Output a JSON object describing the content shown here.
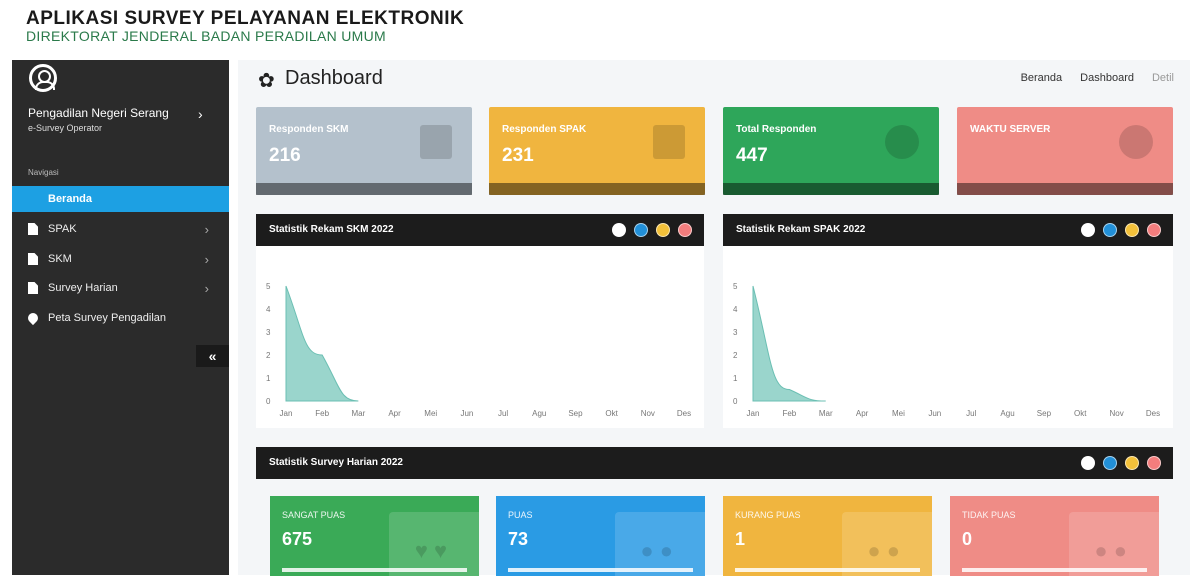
{
  "app": {
    "title": "APLIKASI SURVEY PELAYANAN ELEKTRONIK",
    "subtitle": "DIREKTORAT JENDERAL BADAN PERADILAN UMUM"
  },
  "sidebar": {
    "user_name": "Pengadilan Negeri Serang",
    "user_role": "e-Survey Operator",
    "nav_heading": "Navigasi",
    "items": [
      {
        "label": "Beranda",
        "active": true,
        "icon": "none"
      },
      {
        "label": "SPAK",
        "icon": "file-icon"
      },
      {
        "label": "SKM",
        "icon": "file-icon"
      },
      {
        "label": "Survey Harian",
        "icon": "file-icon"
      },
      {
        "label": "Peta Survey Pengadilan",
        "icon": "map-pin-icon"
      }
    ],
    "collapse_label": "«"
  },
  "main": {
    "page_title": "Dashboard",
    "breadcrumb": [
      "Beranda",
      "Dashboard",
      "Detil"
    ]
  },
  "stat_boxes": [
    {
      "label": "Responden SKM",
      "value": "216",
      "color": "#b4c1cc"
    },
    {
      "label": "Responden SPAK",
      "value": "231",
      "color": "#f0b53f"
    },
    {
      "label": "Total Responden",
      "value": "447",
      "color": "#2ea65a"
    },
    {
      "label": "WAKTU SERVER",
      "value": "",
      "color": "#ef8c86"
    }
  ],
  "panels": {
    "skm_title": "Statistik Rekam SKM 2022",
    "spak_title": "Statistik Rekam SPAK 2022",
    "harian_title": "Statistik Survey Harian 2022"
  },
  "chart_data": [
    {
      "type": "area",
      "categories": [
        "Jan",
        "Feb",
        "Mar",
        "Apr",
        "Mei",
        "Jun",
        "Jul",
        "Agu",
        "Sep",
        "Okt",
        "Nov",
        "Des"
      ],
      "values": [
        5,
        2,
        0,
        0,
        0,
        0,
        0,
        0,
        0,
        0,
        0,
        0
      ],
      "ylim": [
        0,
        5
      ],
      "yticks": [
        0,
        1,
        2,
        3,
        4,
        5
      ],
      "color": "#8fd0c6"
    },
    {
      "type": "area",
      "categories": [
        "Jan",
        "Feb",
        "Mar",
        "Apr",
        "Mei",
        "Jun",
        "Jul",
        "Agu",
        "Sep",
        "Okt",
        "Nov",
        "Des"
      ],
      "values": [
        5,
        0.5,
        0,
        0,
        0,
        0,
        0,
        0,
        0,
        0,
        0,
        0
      ],
      "ylim": [
        0,
        5
      ],
      "yticks": [
        0,
        1,
        2,
        3,
        4,
        5
      ],
      "color": "#8fd0c6"
    }
  ],
  "tiles": [
    {
      "label": "SANGAT PUAS",
      "value": "675",
      "color": "#3aaa57"
    },
    {
      "label": "PUAS",
      "value": "73",
      "color": "#2a9be4"
    },
    {
      "label": "KURANG PUAS",
      "value": "1",
      "color": "#f0b53f"
    },
    {
      "label": "TIDAK PUAS",
      "value": "0",
      "color": "#ef8c86"
    }
  ]
}
